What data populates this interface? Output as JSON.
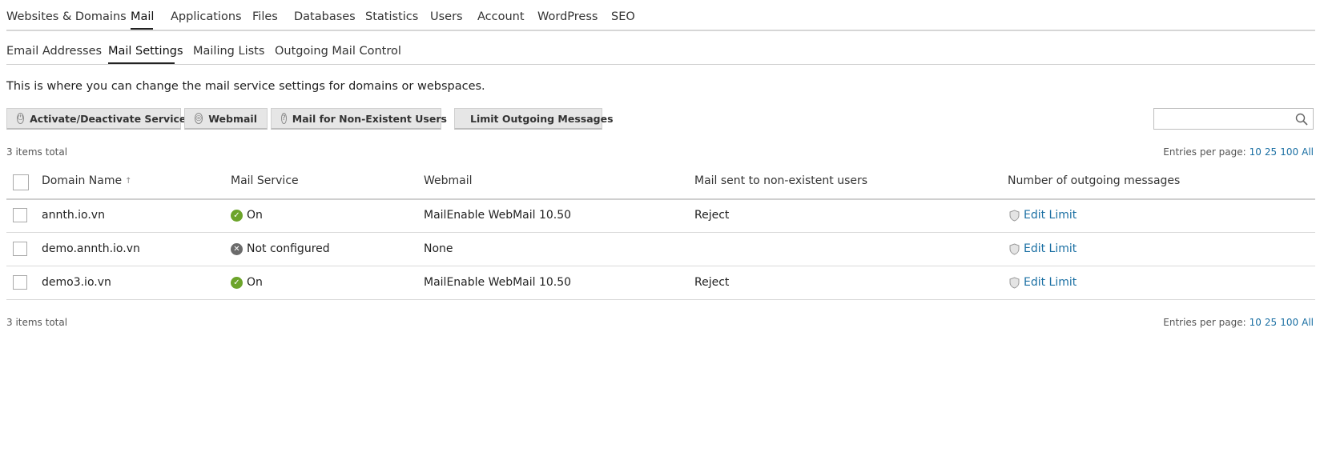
{
  "top_nav": {
    "items": [
      "Websites & Domains",
      "Mail",
      "Applications",
      "Files",
      "Databases",
      "Statistics",
      "Users",
      "Account",
      "WordPress",
      "SEO"
    ],
    "active": "Mail"
  },
  "sub_nav": {
    "items": [
      "Email Addresses",
      "Mail Settings",
      "Mailing Lists",
      "Outgoing Mail Control"
    ],
    "active": "Mail Settings"
  },
  "description": "This is where you can change the mail service settings for domains or webspaces.",
  "toolbar": {
    "activate_label": "Activate/Deactivate Services",
    "webmail_label": "Webmail",
    "nonexistent_label": "Mail for Non-Existent Users",
    "limit_label": "Limit Outgoing Messages",
    "search_placeholder": ""
  },
  "summary": {
    "total_top": "3 items total",
    "total_bottom": "3 items total",
    "entries_label": "Entries per page:",
    "entries_options": [
      "10",
      "25",
      "100",
      "All"
    ]
  },
  "table": {
    "headers": {
      "domain": "Domain Name",
      "domain_sort": "↑",
      "mail_service": "Mail Service",
      "webmail": "Webmail",
      "nonexistent": "Mail sent to non-existent users",
      "outgoing": "Number of outgoing messages"
    },
    "rows": [
      {
        "domain": "annth.io.vn",
        "mail_service": "On",
        "status": "on",
        "webmail": "MailEnable WebMail 10.50",
        "nonexistent": "Reject",
        "outgoing": "Edit Limit"
      },
      {
        "domain": "demo.annth.io.vn",
        "mail_service": "Not configured",
        "status": "off",
        "webmail": "None",
        "nonexistent": "",
        "outgoing": "Edit Limit"
      },
      {
        "domain": "demo3.io.vn",
        "mail_service": "On",
        "status": "on",
        "webmail": "MailEnable WebMail 10.50",
        "nonexistent": "Reject",
        "outgoing": "Edit Limit"
      }
    ]
  },
  "colors": {
    "link": "#1a6fa3",
    "status_on": "#6ca42a",
    "status_off": "#6b6b6b"
  }
}
